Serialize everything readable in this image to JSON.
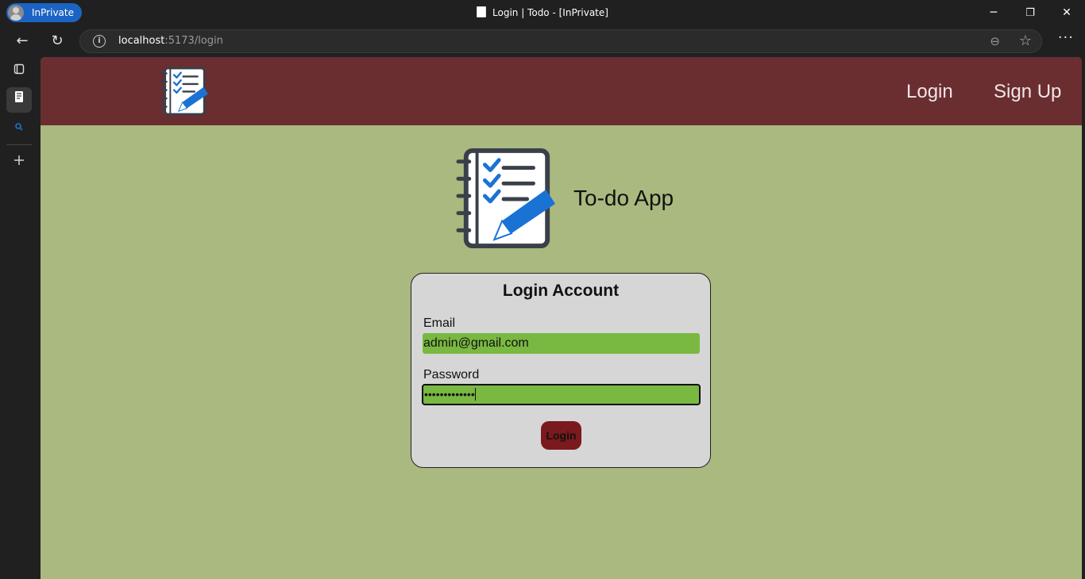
{
  "browser": {
    "inprivate_label": "InPrivate",
    "window_title": "Login | Todo - [InPrivate]",
    "url_host": "localhost",
    "url_rest": ":5173/login",
    "controls": {
      "minimize": "─",
      "restore": "❐",
      "close": "✕"
    },
    "nav": {
      "back": "←",
      "reload": "↻",
      "more": "···",
      "zoom": "⊖",
      "favorite": "☆"
    },
    "sidebar_icons": [
      "tab-actions-icon",
      "page-tab-icon",
      "search-icon",
      "add-icon"
    ]
  },
  "header": {
    "nav_links": [
      "Login",
      "Sign Up"
    ]
  },
  "brand": {
    "title": "To-do App"
  },
  "login_card": {
    "title": "Login Account",
    "email_label": "Email",
    "email_value": "admin@gmail.com",
    "password_label": "Password",
    "password_mask": "•••••••••••••",
    "submit_label": "Login"
  },
  "colors": {
    "header_bg": "#6a2e31",
    "page_bg": "#a9b97f",
    "card_bg": "#d6d6d6",
    "input_bg": "#79b841",
    "button_bg": "#7a1a1e",
    "icon_blue": "#1a73d4",
    "icon_dark": "#3a4049"
  }
}
